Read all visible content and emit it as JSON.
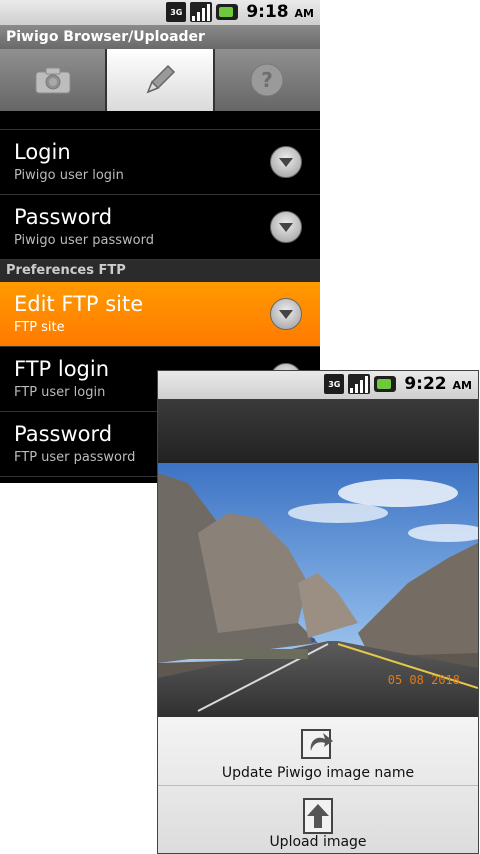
{
  "screen1": {
    "status": {
      "network": "3G",
      "time": "9:18",
      "ampm": "AM"
    },
    "app_title": "Piwigo Browser/Uploader",
    "tabs": [
      {
        "icon": "camera-icon",
        "active": false
      },
      {
        "icon": "pencil-icon",
        "active": true
      },
      {
        "icon": "help-icon",
        "active": false
      }
    ],
    "prefs": [
      {
        "title": "Login",
        "summary": "Piwigo user login"
      },
      {
        "title": "Password",
        "summary": "Piwigo user password"
      }
    ],
    "category_ftp": "Preferences FTP",
    "ftp_prefs": [
      {
        "title": "Edit FTP site",
        "summary": "FTP site",
        "selected": true
      },
      {
        "title": "FTP login",
        "summary": "FTP user login"
      },
      {
        "title": "Password",
        "summary": "FTP user password"
      }
    ]
  },
  "screen2": {
    "status": {
      "network": "3G",
      "time": "9:22",
      "ampm": "AM"
    },
    "photo_date_stamp": "05 08 2018",
    "actions": [
      {
        "label": "Update Piwigo image name",
        "icon": "edit-image-icon"
      },
      {
        "label": "Upload image",
        "icon": "upload-icon"
      }
    ]
  },
  "colors": {
    "selected_orange": "#ff8c00",
    "title_gray": "#7a7a7a"
  }
}
